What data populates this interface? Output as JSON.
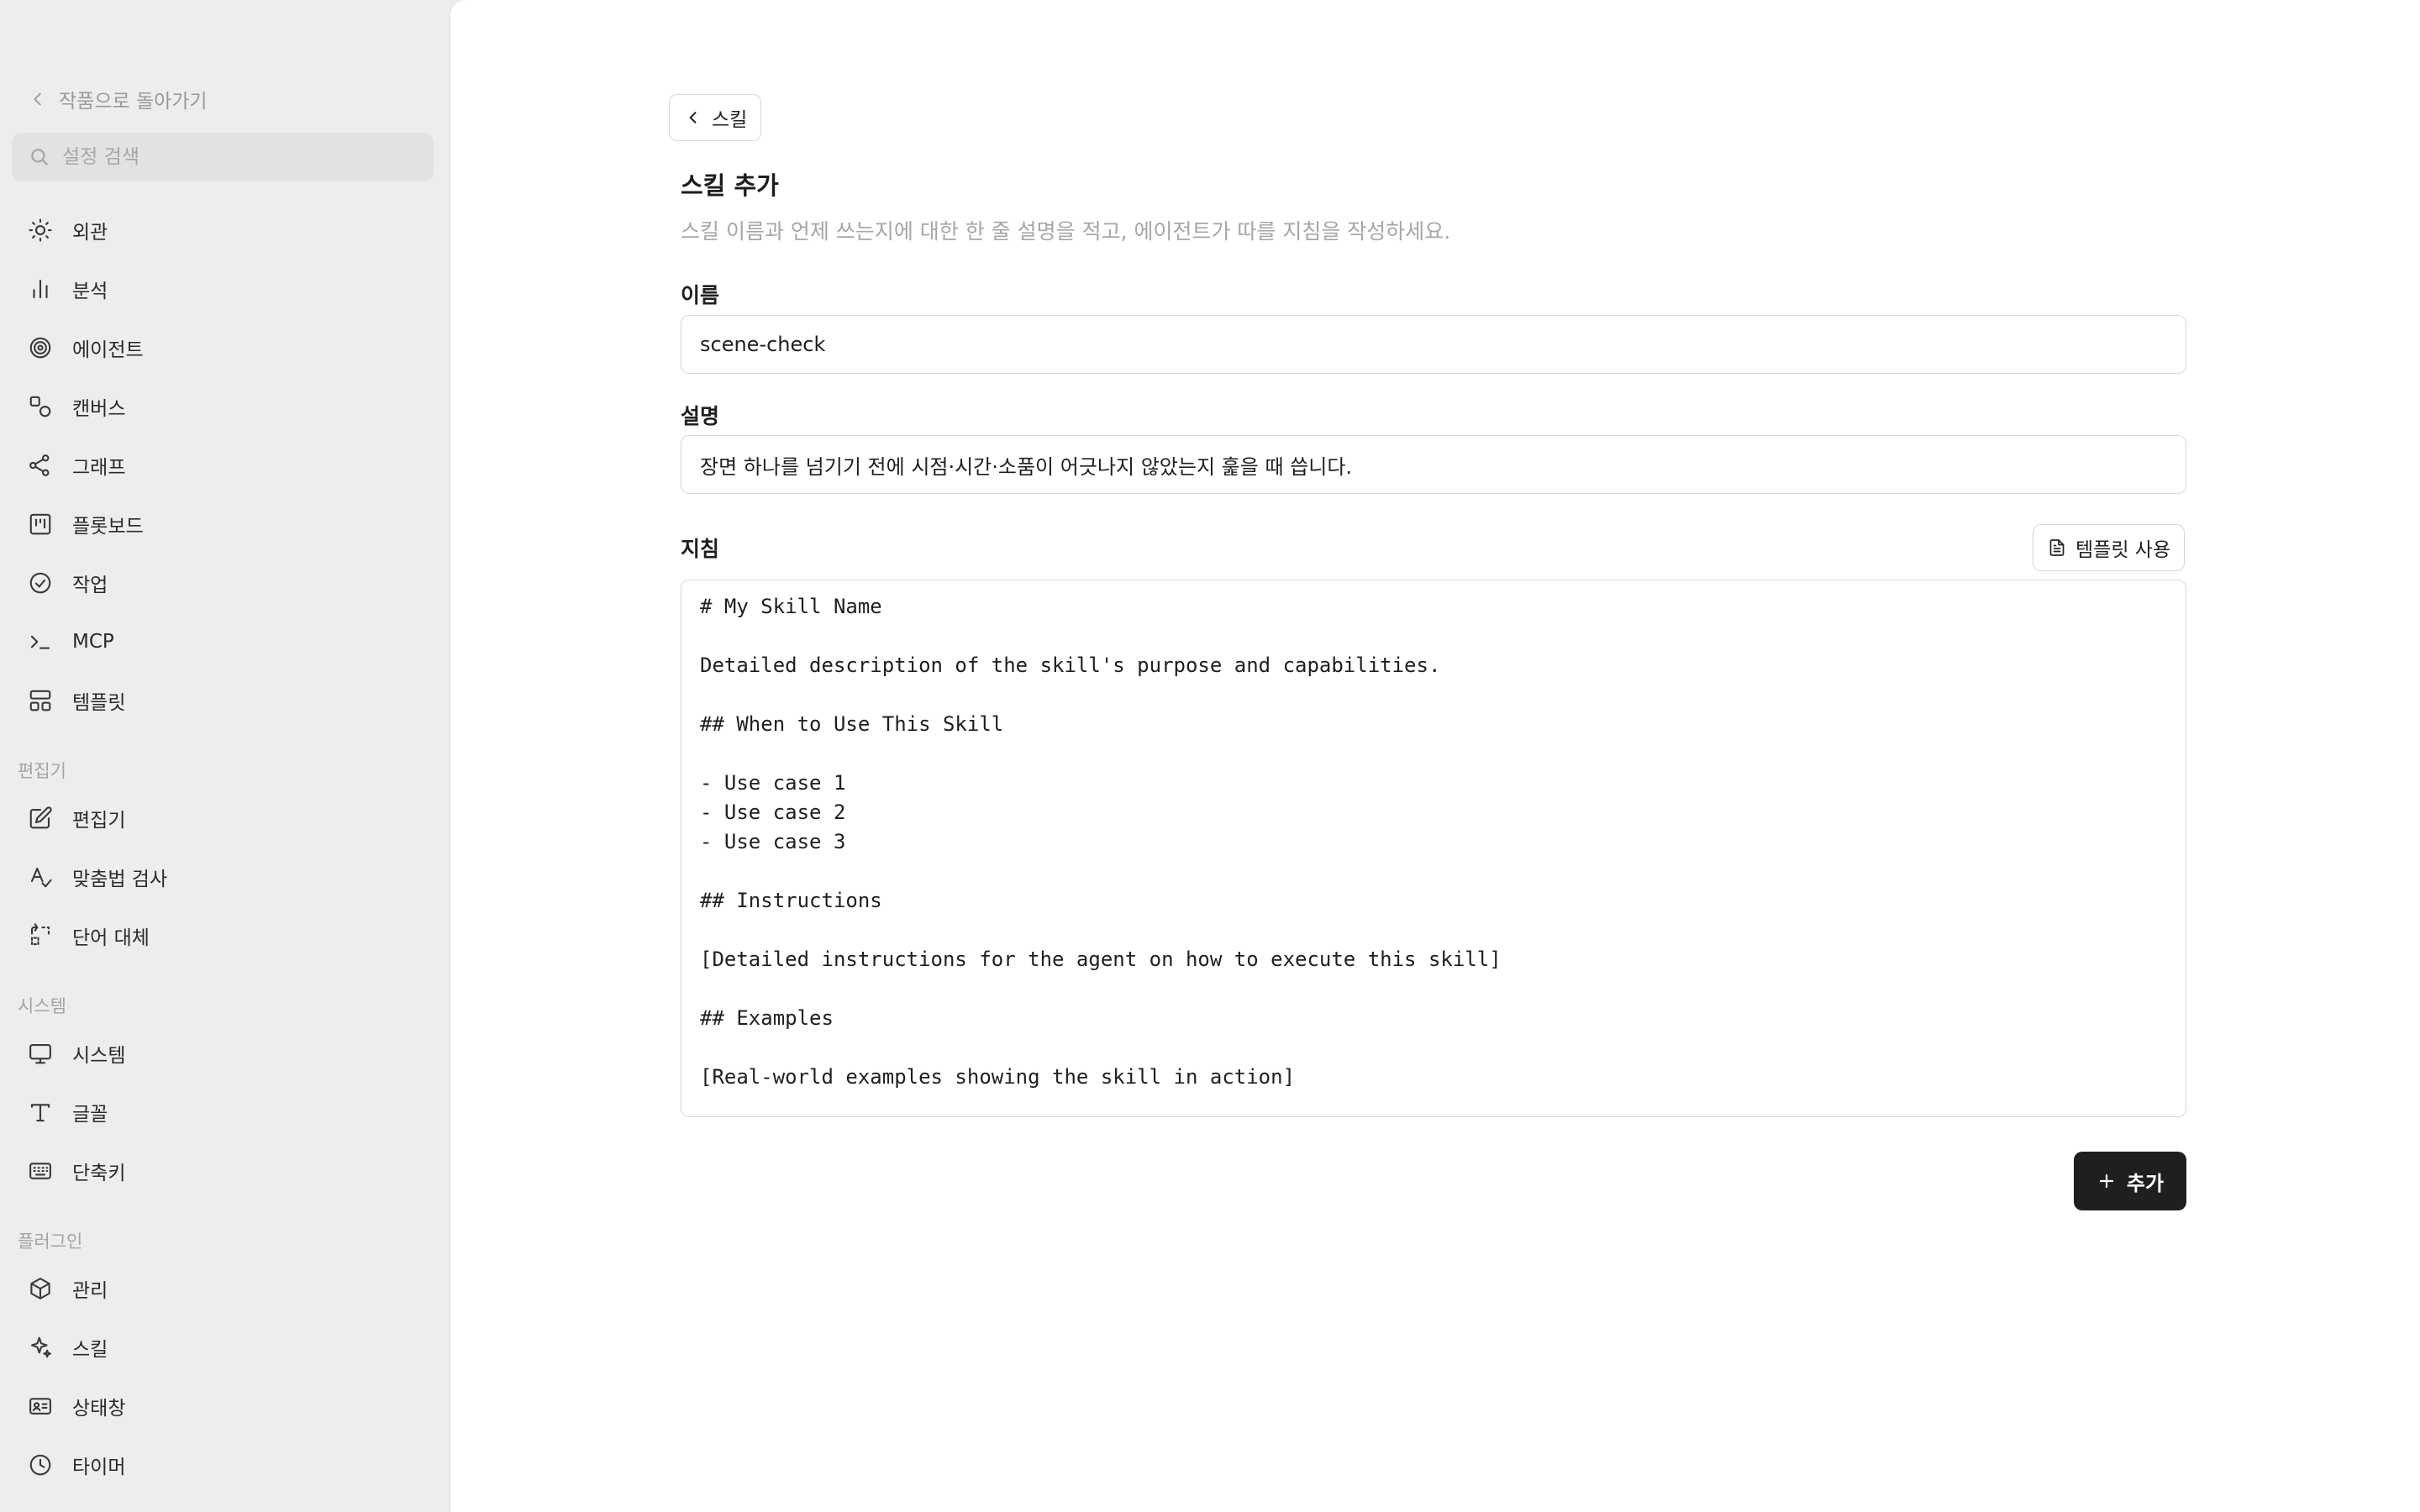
{
  "sidebar": {
    "back_label": "작품으로 돌아가기",
    "search_placeholder": "설정 검색",
    "items": [
      {
        "label": "외관",
        "icon": "sun-icon"
      },
      {
        "label": "분석",
        "icon": "bar-chart-icon"
      },
      {
        "label": "에이전트",
        "icon": "spiral-icon"
      },
      {
        "label": "캔버스",
        "icon": "shapes-icon"
      },
      {
        "label": "그래프",
        "icon": "graph-icon"
      },
      {
        "label": "플롯보드",
        "icon": "kanban-icon"
      },
      {
        "label": "작업",
        "icon": "check-circle-icon"
      },
      {
        "label": "MCP",
        "icon": "terminal-icon"
      },
      {
        "label": "템플릿",
        "icon": "layout-icon"
      }
    ],
    "sections": [
      {
        "label": "편집기",
        "items": [
          {
            "label": "편집기",
            "icon": "edit-icon"
          },
          {
            "label": "맞춤법 검사",
            "icon": "spellcheck-icon"
          },
          {
            "label": "단어 대체",
            "icon": "replace-icon"
          }
        ]
      },
      {
        "label": "시스템",
        "items": [
          {
            "label": "시스템",
            "icon": "monitor-icon"
          },
          {
            "label": "글꼴",
            "icon": "type-icon"
          },
          {
            "label": "단축키",
            "icon": "keyboard-icon"
          }
        ]
      },
      {
        "label": "플러그인",
        "items": [
          {
            "label": "관리",
            "icon": "package-icon"
          },
          {
            "label": "스킬",
            "icon": "sparkles-icon"
          },
          {
            "label": "상태창",
            "icon": "id-card-icon"
          },
          {
            "label": "타이머",
            "icon": "clock-icon"
          }
        ]
      }
    ]
  },
  "main": {
    "breadcrumb_label": "스킬",
    "title": "스킬 추가",
    "subtitle": "스킬 이름과 언제 쓰는지에 대한 한 줄 설명을 적고, 에이전트가 따를 지침을 작성하세요.",
    "name_label": "이름",
    "name_value": "scene-check",
    "description_label": "설명",
    "description_value": "장면 하나를 넘기기 전에 시점·시간·소품이 어긋나지 않았는지 훑을 때 씁니다.",
    "instructions_label": "지침",
    "template_button": "템플릿 사용",
    "instructions_value": "# My Skill Name\n\nDetailed description of the skill's purpose and capabilities.\n\n## When to Use This Skill\n\n- Use case 1\n- Use case 2\n- Use case 3\n\n## Instructions\n\n[Detailed instructions for the agent on how to execute this skill]\n\n## Examples\n\n[Real-world examples showing the skill in action]",
    "add_button": "추가"
  }
}
